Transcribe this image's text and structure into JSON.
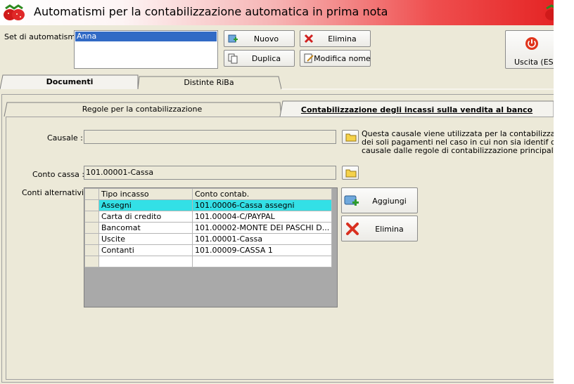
{
  "window": {
    "title": "Automatismi per la contabilizzazione automatica in prima nota"
  },
  "set": {
    "label": "Set di automatismi :",
    "items": [
      "Anna"
    ]
  },
  "buttons": {
    "nuovo": "Nuovo",
    "elimina": "Elimina",
    "duplica": "Duplica",
    "modifica_nome": "Modifica nome",
    "uscita": "Uscita (ESC)"
  },
  "tabs_main": [
    "Documenti",
    "Distinte RiBa"
  ],
  "tabs_sub": [
    "Regole per la contabilizzazione",
    "Contabilizzazione degli incassi sulla vendita al banco"
  ],
  "form": {
    "causale_label": "Causale :",
    "causale_value": "",
    "causale_note": [
      "Questa causale viene utilizzata per la contabilizzazione",
      "dei soli pagamenti nel caso in cui non sia identif cata una",
      "causale dalle regole di contabilizzazione principale"
    ],
    "conto_cassa_label": "Conto cassa :",
    "conto_cassa_value": "101.00001-Cassa",
    "conti_alt_label": "Conti alternativi :"
  },
  "grid": {
    "headers": [
      "Tipo incasso",
      "Conto contab."
    ],
    "rows": [
      [
        "Assegni",
        "101.00006-Cassa assegni"
      ],
      [
        "Carta di credito",
        "101.00004-C/PAYPAL"
      ],
      [
        "Bancomat",
        "101.00002-MONTE DEI PASCHI D..."
      ],
      [
        "Uscite",
        "101.00001-Cassa"
      ],
      [
        "Contanti",
        "101.00009-CASSA 1"
      ],
      [
        "",
        ""
      ]
    ]
  },
  "grid_buttons": {
    "aggiungi": "Aggiungi",
    "elimina": "Elimina"
  },
  "colors": {
    "selected_row": "#33e0e6",
    "title_gradient_end": "#e52525",
    "list_selection": "#316ac5"
  }
}
